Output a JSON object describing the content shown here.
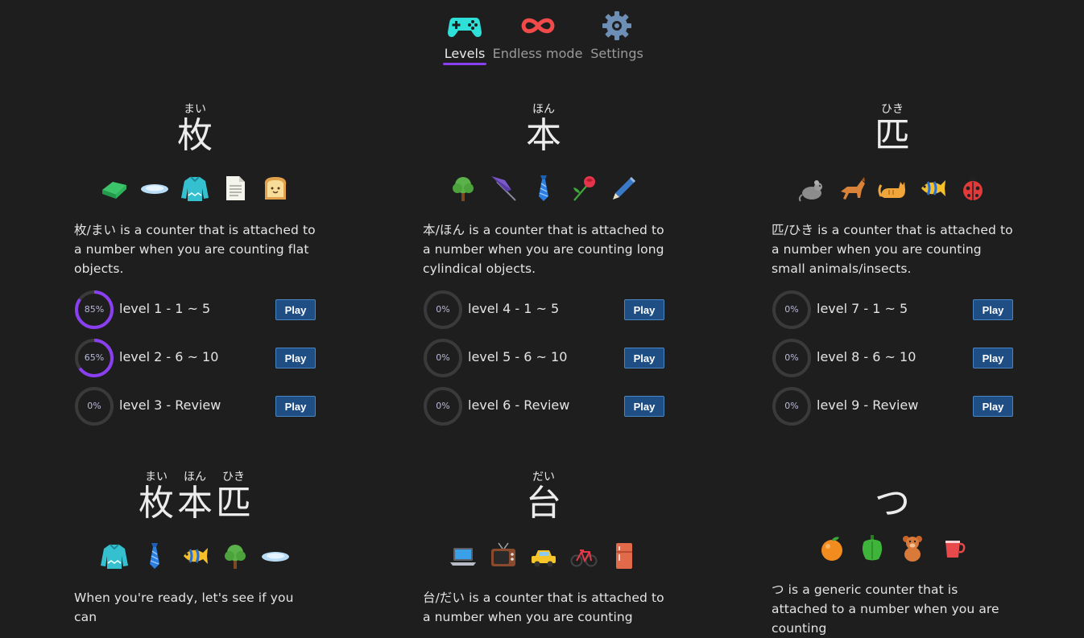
{
  "nav": {
    "items": [
      {
        "label": "Levels",
        "icon": "gamepad-icon",
        "active": true
      },
      {
        "label": "Endless mode",
        "icon": "infinity-icon",
        "active": false
      },
      {
        "label": "Settings",
        "icon": "gear-icon",
        "active": false
      }
    ]
  },
  "colors": {
    "background": "#1e1e1e",
    "accent": "#8a3ff0",
    "play_button": "#1f4e85",
    "ring_track": "#3a3a3a"
  },
  "cards": [
    {
      "counters": [
        {
          "kanji": "枚",
          "reading": "まい"
        }
      ],
      "icons": [
        "eraser-icon",
        "plate-icon",
        "sweater-icon",
        "paper-icon",
        "bread-icon"
      ],
      "description": "枚/まい is a counter that is attached to a number when you are counting flat objects.",
      "levels": [
        {
          "percent_label": "85%",
          "progress": 0.85,
          "label": "level 1 - 1 ~ 5",
          "button": "Play"
        },
        {
          "percent_label": "65%",
          "progress": 0.65,
          "label": "level 2 - 6 ~ 10",
          "button": "Play"
        },
        {
          "percent_label": "0%",
          "progress": 0,
          "label": "level 3 - Review",
          "button": "Play"
        }
      ]
    },
    {
      "counters": [
        {
          "kanji": "本",
          "reading": "ほん"
        }
      ],
      "icons": [
        "tree-icon",
        "umbrella-icon",
        "necktie-icon",
        "rose-icon",
        "pen-icon"
      ],
      "description": "本/ほん is a counter that is attached to a number when you are counting long cylindical objects.",
      "levels": [
        {
          "percent_label": "0%",
          "progress": 0,
          "label": "level 4 - 1 ~ 5",
          "button": "Play"
        },
        {
          "percent_label": "0%",
          "progress": 0,
          "label": "level 5 - 6 ~ 10",
          "button": "Play"
        },
        {
          "percent_label": "0%",
          "progress": 0,
          "label": "level 6 - Review",
          "button": "Play"
        }
      ]
    },
    {
      "counters": [
        {
          "kanji": "匹",
          "reading": "ひき"
        }
      ],
      "icons": [
        "rat-icon",
        "dog-icon",
        "cat-icon",
        "fish-icon",
        "ladybug-icon"
      ],
      "description": "匹/ひき is a counter that is attached to a number when you are counting small animals/insects.",
      "levels": [
        {
          "percent_label": "0%",
          "progress": 0,
          "label": "level 7 - 1 ~ 5",
          "button": "Play"
        },
        {
          "percent_label": "0%",
          "progress": 0,
          "label": "level 8 - 6 ~ 10",
          "button": "Play"
        },
        {
          "percent_label": "0%",
          "progress": 0,
          "label": "level 9 - Review",
          "button": "Play"
        }
      ]
    },
    {
      "counters": [
        {
          "kanji": "枚",
          "reading": "まい"
        },
        {
          "kanji": "本",
          "reading": "ほん"
        },
        {
          "kanji": "匹",
          "reading": "ひき"
        }
      ],
      "icons": [
        "sweater-icon",
        "necktie-icon",
        "fish-icon",
        "tree-icon",
        "plate-icon"
      ],
      "description": "When you're ready, let's see if you can",
      "levels": []
    },
    {
      "counters": [
        {
          "kanji": "台",
          "reading": "だい"
        }
      ],
      "icons": [
        "laptop-icon",
        "television-icon",
        "taxi-icon",
        "bicycle-icon",
        "refrigerator-icon"
      ],
      "description": "台/だい is a counter that is attached to a number when you are counting",
      "levels": []
    },
    {
      "counters": [
        {
          "kanji": "つ",
          "reading": ""
        }
      ],
      "icons": [
        "orange-icon",
        "pepper-icon",
        "teddy-bear-icon",
        "cup-icon"
      ],
      "description": "つ is a generic counter that is attached to a number when you are counting",
      "levels": []
    }
  ]
}
